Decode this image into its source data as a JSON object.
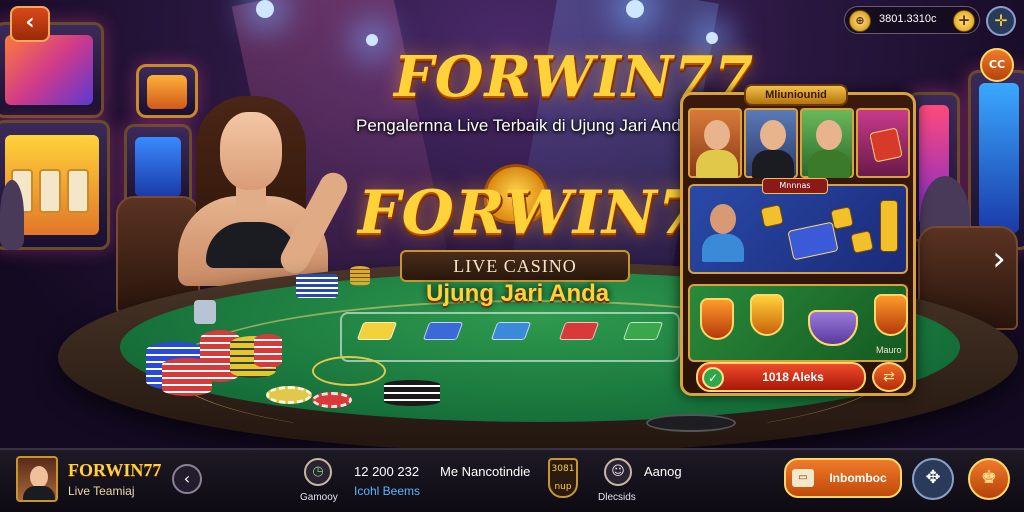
{
  "header": {
    "back_icon": "chevron-left-icon",
    "balance": "3801.3310c",
    "balance_coin_symbol": "⊕",
    "add_symbol": "+",
    "settings_symbol": "✛",
    "side_badge": "CC"
  },
  "hero": {
    "logo_top": "FORWIN77",
    "tagline": "Pengalernna Live  Terbaik di Ujung Jari Anda",
    "logo_mid": "FORWIN77",
    "banner": "LIVE CASINO",
    "slogan": "Ujung Jari Anda"
  },
  "game_panel": {
    "title": "Mliuniounid",
    "section_label": "Mnnnas",
    "small_text": "Mauro",
    "claim_label": "1018 Aleks",
    "claim_icon": "✓",
    "round_icon": "⇄"
  },
  "carousel": {
    "next_symbol": "›"
  },
  "bottom_bar": {
    "brand": "FORWIN77",
    "sub": "Live Teamiaj",
    "prev_symbol": "‹",
    "item1_label": "Gamooy",
    "item1_icon": "◷",
    "count": "12 200 232",
    "count_sub": "Icohl Beems",
    "title": "Me Nancotindie",
    "badge": "3081 nup",
    "item3_label": "Dlecsids",
    "item3_icon": "☺",
    "right_label": "Aanog",
    "cta_label": "Inbomboc",
    "cta_icon": "▭",
    "round1_symbol": "✥",
    "round2_symbol": "♚"
  },
  "colors": {
    "gold": "#ffd23a",
    "felt": "#16703a",
    "accent_orange": "#f07a2a",
    "panel_border": "#d9a23a"
  }
}
